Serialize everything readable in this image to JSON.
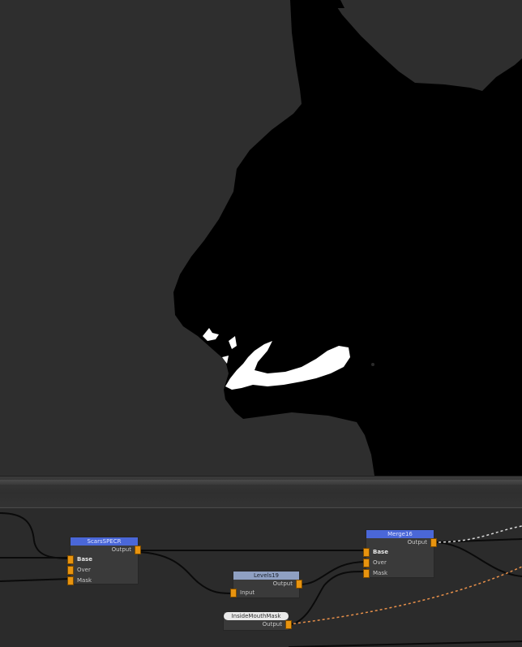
{
  "viewer": {
    "background": "#2e2e2e",
    "silhouette_color": "#000000",
    "highlight_color": "#ffffff"
  },
  "graph": {
    "wire_color": "#0a0a0a",
    "dashed_wire_color": "#e8904a",
    "port_color": "#e8940f",
    "nodes": {
      "scars": {
        "title": "ScarsSPECR",
        "output": "Output",
        "inputs": [
          "Base",
          "Over",
          "Mask"
        ]
      },
      "levels": {
        "title": "Levels19",
        "output": "Output",
        "inputs": [
          "Input"
        ]
      },
      "merge": {
        "title": "Merge16",
        "output": "Output",
        "inputs": [
          "Base",
          "Over",
          "Mask"
        ]
      },
      "mouth": {
        "title": "InsideMouthMask",
        "output": "Output"
      }
    }
  }
}
